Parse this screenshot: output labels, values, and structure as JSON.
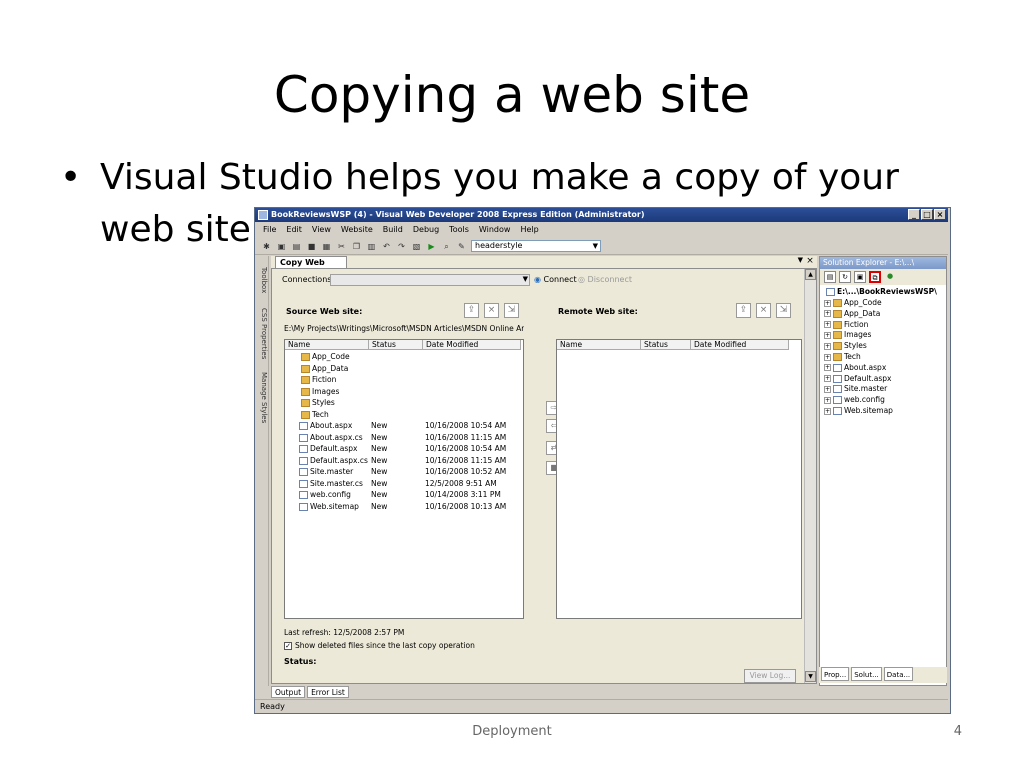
{
  "slide": {
    "title": "Copying a web site",
    "bullet_line1": "Visual Studio helps you make a copy of your",
    "bullet_line2": "web site",
    "bullet_dot": "•",
    "footer": "Deployment",
    "page_number": "4"
  },
  "window": {
    "title": "BookReviewsWSP (4) - Visual Web Developer 2008 Express Edition (Administrator)",
    "menu": [
      "File",
      "Edit",
      "View",
      "Website",
      "Build",
      "Debug",
      "Tools",
      "Window",
      "Help"
    ],
    "toolbar_combo": "headerstyle",
    "doc_tab": "Copy Web E:\\...\\",
    "left_tabs": [
      "Toolbox",
      "CSS Properties",
      "Manage Styles"
    ],
    "status": "Ready",
    "bottom_tabs": [
      "Output",
      "Error List"
    ]
  },
  "copyweb": {
    "connections_label": "Connections:",
    "connect_label": "Connect",
    "disconnect_label": "Disconnect",
    "source_label": "Source Web site:",
    "remote_label": "Remote Web site:",
    "source_path": "E:\\My Projects\\Writings\\Microsoft\\MSDN Articles\\MSDN Online Articles\\Ho",
    "columns": [
      "Name",
      "Status",
      "Date Modified"
    ],
    "source_files": [
      {
        "name": "App_Code",
        "status": "",
        "date": "",
        "type": "folder"
      },
      {
        "name": "App_Data",
        "status": "",
        "date": "",
        "type": "folder"
      },
      {
        "name": "Fiction",
        "status": "",
        "date": "",
        "type": "folder"
      },
      {
        "name": "Images",
        "status": "",
        "date": "",
        "type": "folder"
      },
      {
        "name": "Styles",
        "status": "",
        "date": "",
        "type": "folder"
      },
      {
        "name": "Tech",
        "status": "",
        "date": "",
        "type": "folder"
      },
      {
        "name": "About.aspx",
        "status": "New",
        "date": "10/16/2008 10:54 AM",
        "type": "file"
      },
      {
        "name": "About.aspx.cs",
        "status": "New",
        "date": "10/16/2008 11:15 AM",
        "type": "file"
      },
      {
        "name": "Default.aspx",
        "status": "New",
        "date": "10/16/2008 10:54 AM",
        "type": "file"
      },
      {
        "name": "Default.aspx.cs",
        "status": "New",
        "date": "10/16/2008 11:15 AM",
        "type": "file"
      },
      {
        "name": "Site.master",
        "status": "New",
        "date": "10/16/2008 10:52 AM",
        "type": "file"
      },
      {
        "name": "Site.master.cs",
        "status": "New",
        "date": "12/5/2008 9:51 AM",
        "type": "file"
      },
      {
        "name": "web.config",
        "status": "New",
        "date": "10/14/2008 3:11 PM",
        "type": "file"
      },
      {
        "name": "Web.sitemap",
        "status": "New",
        "date": "10/16/2008 10:13 AM",
        "type": "file"
      }
    ],
    "last_refresh": "Last refresh: 12/5/2008 2:57 PM",
    "show_deleted": "Show deleted files since the last copy operation",
    "status_label": "Status:",
    "view_log": "View Log..."
  },
  "solution_explorer": {
    "title": "Solution Explorer - E:\\...\\",
    "root": "E:\\...\\BookReviewsWSP\\",
    "items": [
      "App_Code",
      "App_Data",
      "Fiction",
      "Images",
      "Styles",
      "Tech",
      "About.aspx",
      "Default.aspx",
      "Site.master",
      "web.config",
      "Web.sitemap"
    ],
    "tabs": [
      "Prop...",
      "Solut...",
      "Data..."
    ]
  }
}
